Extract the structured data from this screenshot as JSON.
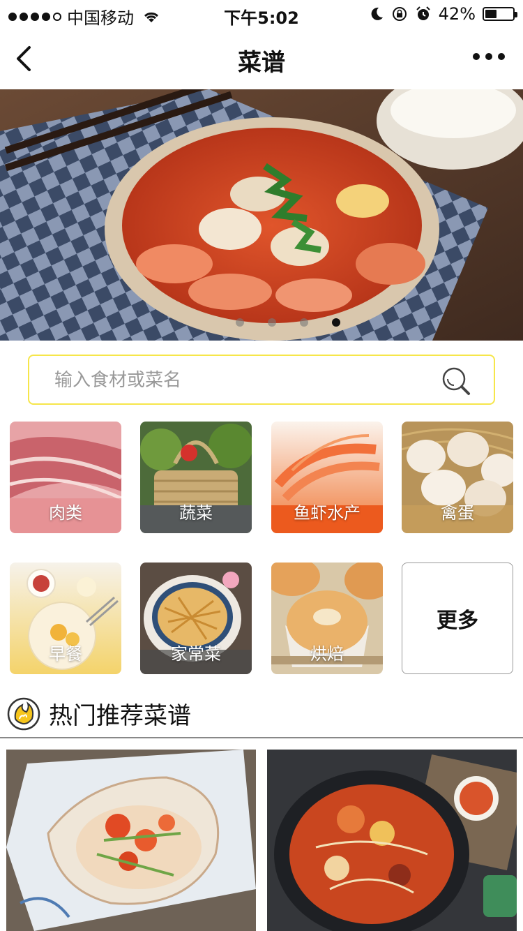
{
  "status_bar": {
    "carrier": "中国移动",
    "time": "下午5:02",
    "battery_percent": "42%",
    "battery_level": 0.42
  },
  "nav": {
    "title": "菜谱"
  },
  "banner": {
    "total_slides": 4,
    "active_slide": 4
  },
  "search": {
    "placeholder": "输入食材或菜名",
    "value": ""
  },
  "categories": [
    {
      "label": "肉类",
      "icon": "meat-image"
    },
    {
      "label": "蔬菜",
      "icon": "vegetable-basket-image"
    },
    {
      "label": "鱼虾水产",
      "icon": "shrimp-image"
    },
    {
      "label": "禽蛋",
      "icon": "eggs-image"
    },
    {
      "label": "早餐",
      "icon": "breakfast-image"
    },
    {
      "label": "家常菜",
      "icon": "home-dish-image"
    },
    {
      "label": "烘焙",
      "icon": "bread-image"
    },
    {
      "label": "更多",
      "icon": ""
    }
  ],
  "hot": {
    "title": "热门推荐菜谱"
  },
  "recipes": [
    {
      "icon": "steamed-crab-image"
    },
    {
      "icon": "army-stew-image"
    }
  ],
  "colors": {
    "search_border": "#f6e64a",
    "accent": "#f6c51c"
  }
}
